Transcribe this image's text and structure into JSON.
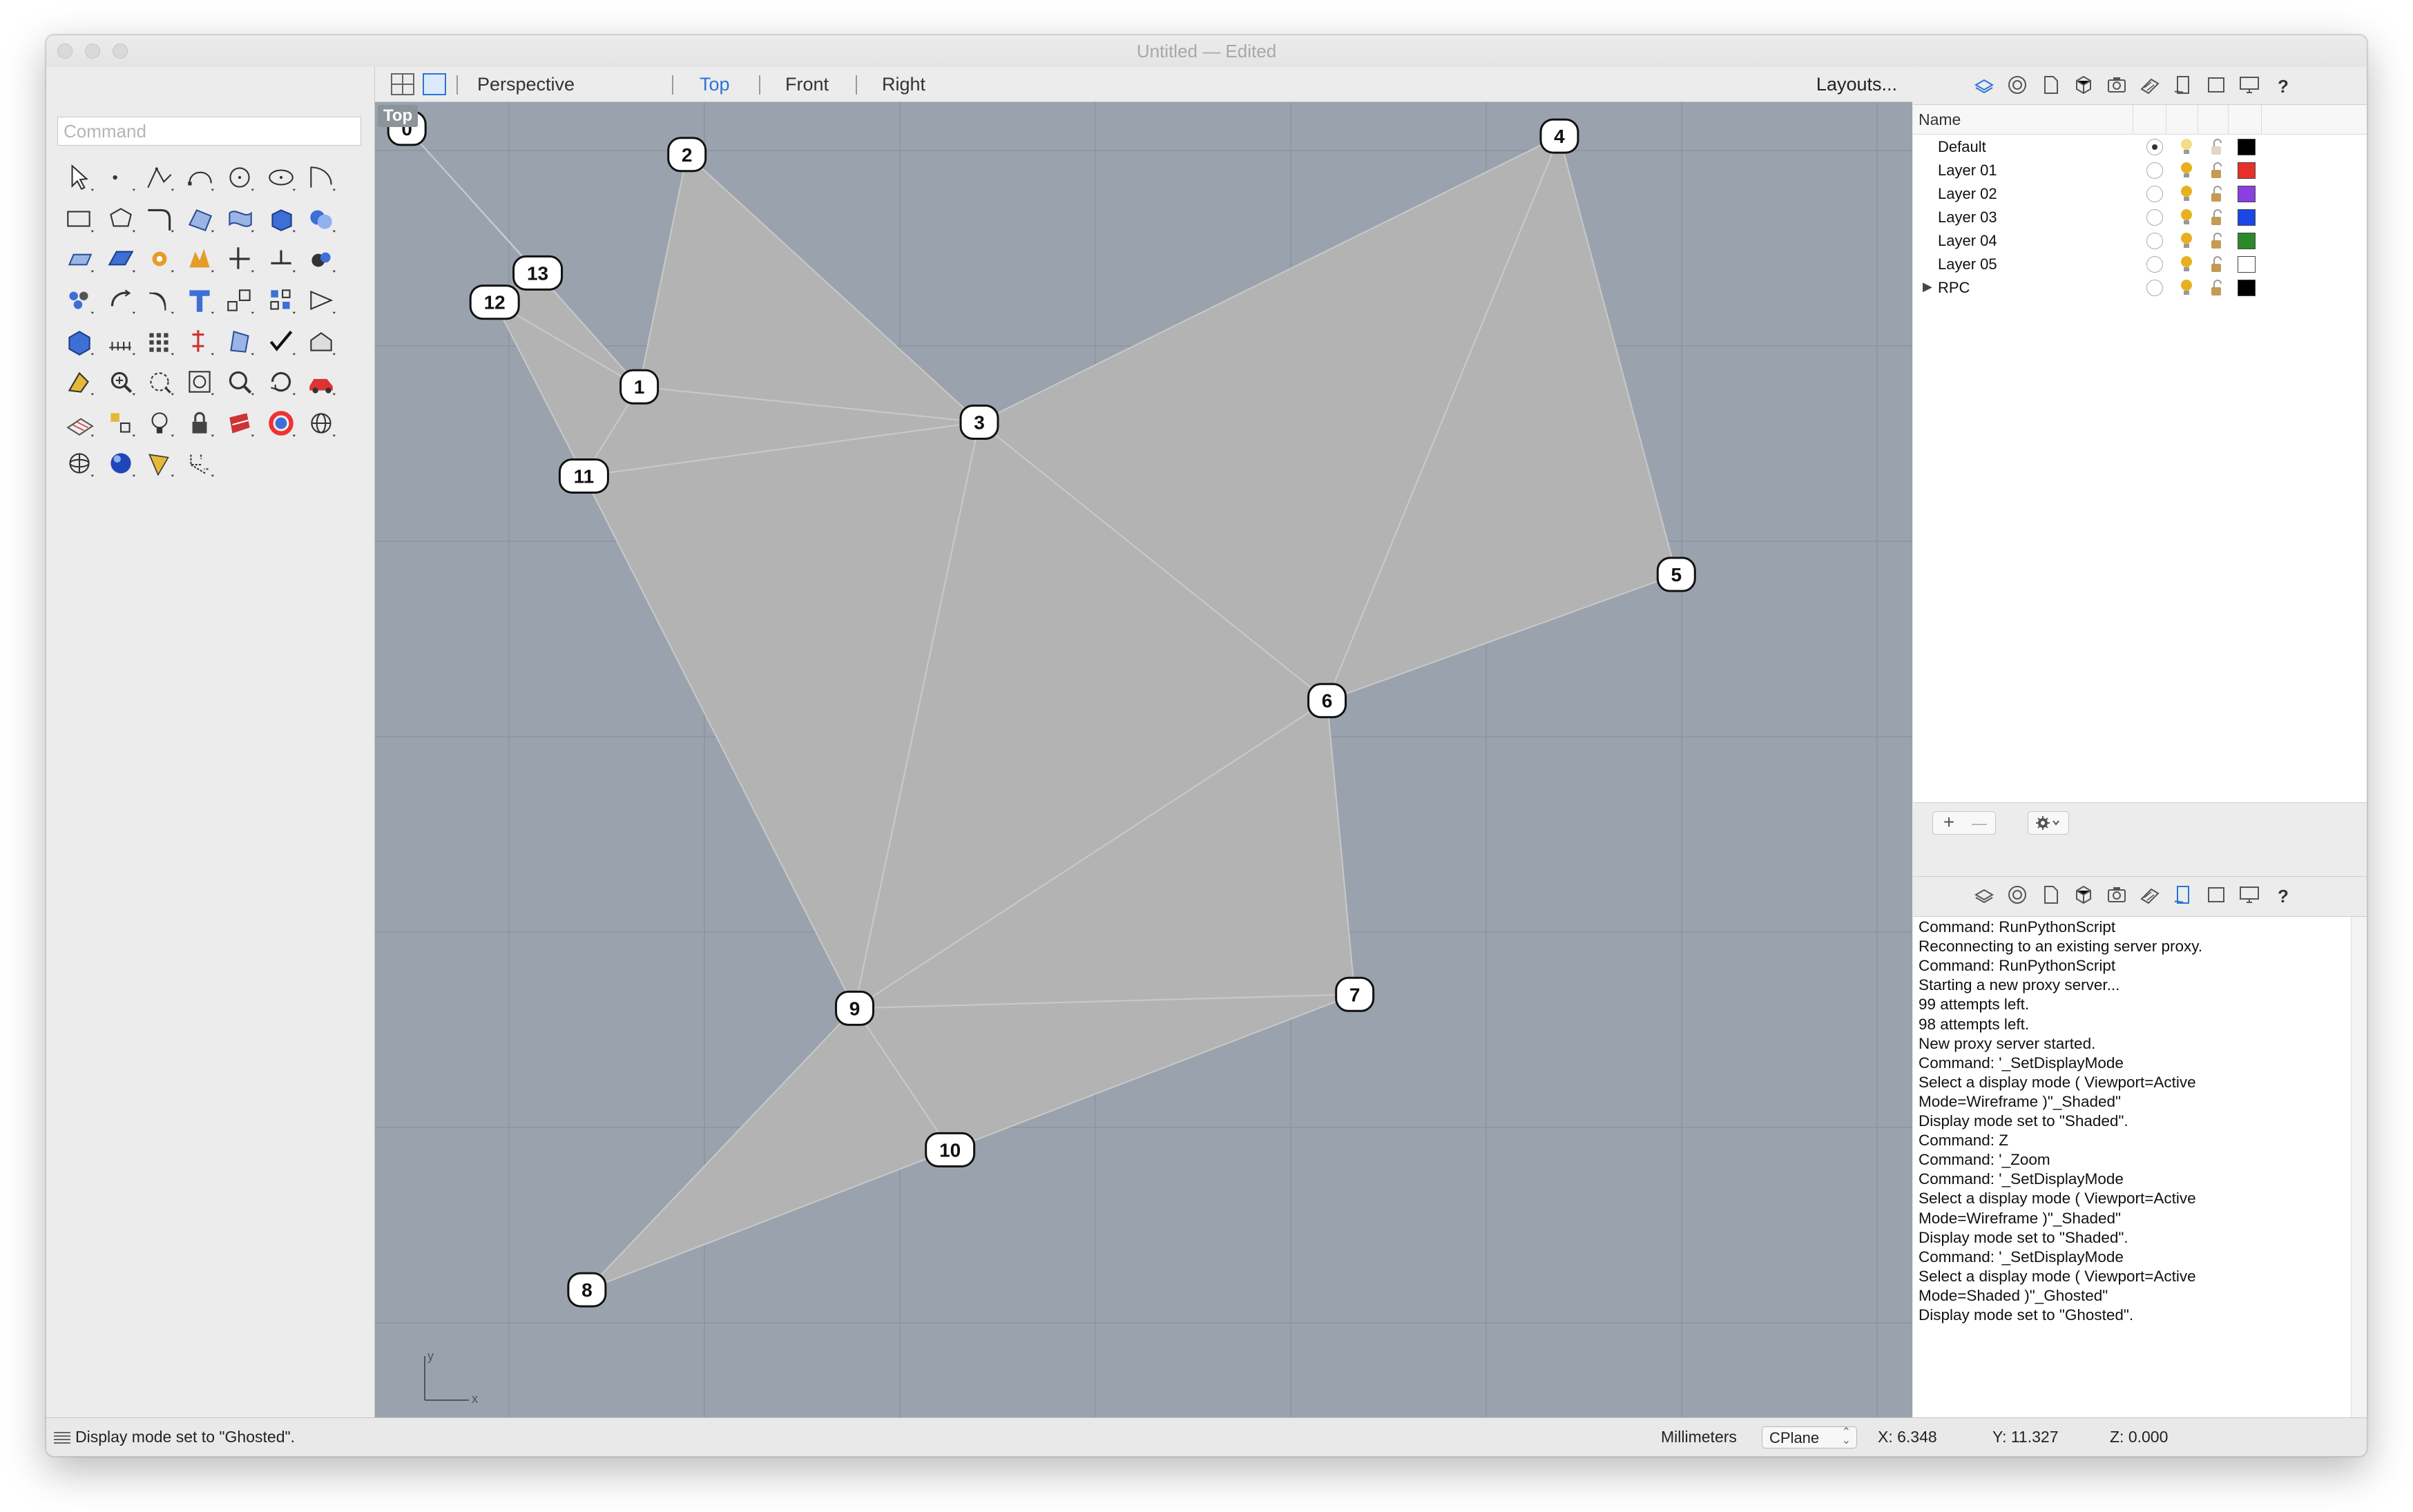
{
  "window": {
    "title": "Untitled — Edited"
  },
  "command": {
    "placeholder": "Command"
  },
  "viewport_tabs": {
    "tabs": [
      "Perspective",
      "Top",
      "Front",
      "Right"
    ],
    "active": "Top",
    "layouts_label": "Layouts..."
  },
  "viewport": {
    "label": "Top",
    "axis_x": "x",
    "axis_y": "y",
    "colors": {
      "background": "#9aa3ad",
      "mesh_fill": "#b3b3b3",
      "grid": "#8f98a2"
    },
    "nodes": [
      {
        "id": "0"
      },
      {
        "id": "1"
      },
      {
        "id": "2"
      },
      {
        "id": "3"
      },
      {
        "id": "4"
      },
      {
        "id": "5"
      },
      {
        "id": "6"
      },
      {
        "id": "7"
      },
      {
        "id": "8"
      },
      {
        "id": "9"
      },
      {
        "id": "10"
      },
      {
        "id": "11"
      },
      {
        "id": "12"
      },
      {
        "id": "13"
      }
    ],
    "triangles": [
      [
        "0",
        "13",
        "1"
      ],
      [
        "13",
        "12",
        "1"
      ],
      [
        "12",
        "11",
        "1"
      ],
      [
        "1",
        "2",
        "3"
      ],
      [
        "1",
        "3",
        "11"
      ],
      [
        "3",
        "4",
        "6"
      ],
      [
        "4",
        "5",
        "6"
      ],
      [
        "11",
        "3",
        "9"
      ],
      [
        "3",
        "6",
        "9"
      ],
      [
        "6",
        "7",
        "9"
      ],
      [
        "9",
        "7",
        "10"
      ],
      [
        "9",
        "10",
        "8"
      ]
    ]
  },
  "layers": {
    "header": "Name",
    "rows": [
      {
        "name": "Default",
        "current": true,
        "color": "#000000",
        "expandable": false
      },
      {
        "name": "Layer 01",
        "current": false,
        "color": "#e8302a",
        "expandable": false
      },
      {
        "name": "Layer 02",
        "current": false,
        "color": "#8a3fe0",
        "expandable": false
      },
      {
        "name": "Layer 03",
        "current": false,
        "color": "#1a47e6",
        "expandable": false
      },
      {
        "name": "Layer 04",
        "current": false,
        "color": "#2a8a2a",
        "expandable": false
      },
      {
        "name": "Layer 05",
        "current": false,
        "color": "#ffffff",
        "expandable": false
      },
      {
        "name": "RPC",
        "current": false,
        "color": "#000000",
        "expandable": true
      }
    ],
    "add_label": "+",
    "remove_label": "—"
  },
  "panel_icons": [
    "layers-icon",
    "materials-icon",
    "document-icon",
    "object-properties-icon",
    "camera-icon",
    "display-icon",
    "notes-icon",
    "viewport-icon",
    "monitor-icon",
    "help-icon"
  ],
  "console": {
    "lines": [
      "Command: RunPythonScript",
      "Reconnecting to an existing server proxy.",
      "Command: RunPythonScript",
      "Starting a new proxy server...",
      "    99 attempts left.",
      "    98 attempts left.",
      "New proxy server started.",
      "Command: '_SetDisplayMode",
      "Select a display mode ( Viewport=Active",
      "Mode=Wireframe )\"_Shaded\"",
      "Display mode set to \"Shaded\".",
      "Command: Z",
      "Command: '_Zoom",
      "Command: '_SetDisplayMode",
      "Select a display mode ( Viewport=Active",
      "Mode=Wireframe )\"_Shaded\"",
      "Display mode set to \"Shaded\".",
      "Command: '_SetDisplayMode",
      "Select a display mode ( Viewport=Active",
      "Mode=Shaded )\"_Ghosted\"",
      "Display mode set to \"Ghosted\"."
    ]
  },
  "status": {
    "message": "Display mode set to \"Ghosted\".",
    "units": "Millimeters",
    "cplane": "CPlane",
    "x": "X: 6.348",
    "y": "Y: 11.327",
    "z": "Z: 0.000"
  }
}
